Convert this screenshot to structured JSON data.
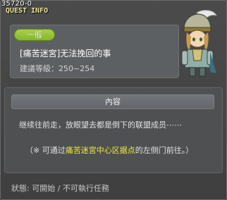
{
  "window": {
    "id": "35720-0",
    "title": "QUEST INFO"
  },
  "quest": {
    "category_badge": "一般",
    "name": "[痛苦迷宮]无法挽回的事",
    "level_requirement": "建議等級：250~254"
  },
  "content": {
    "header": "內容",
    "description": "继续往前走，放眼望去都是倒下的联盟成员⋯⋯",
    "note_prefix": "（※ 可通过",
    "note_highlight": "痛苦迷宮中心区据点",
    "note_suffix": "的左侧门前往。）"
  },
  "footer": {
    "status": "狀態: 可開始 / 不可執行任務"
  },
  "colors": {
    "title": "#f0e49a",
    "badge": "#96c23a",
    "highlight": "#f3ea3c"
  },
  "icons": {
    "portrait": "npc-knight-portrait"
  }
}
